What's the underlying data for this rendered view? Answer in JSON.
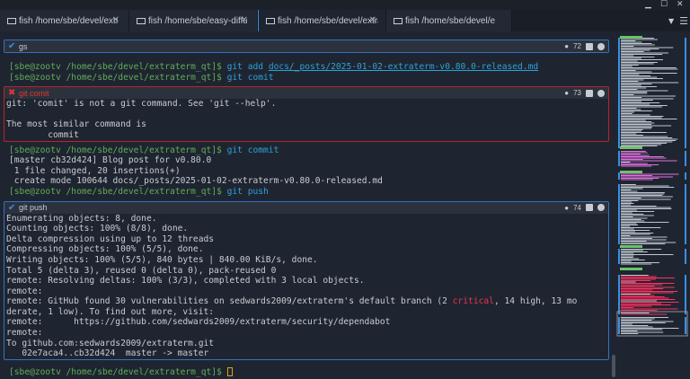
{
  "window": {
    "controls": [
      "minimize",
      "maximize",
      "close"
    ]
  },
  "tabs": [
    {
      "label": "fish /home/sbe/devel/extraterm_qt",
      "active": false
    },
    {
      "label": "fish /home/sbe/easy-diffusion/models",
      "active": false
    },
    {
      "label": "fish /home/sbe/devel/extraterm_qt",
      "active": true
    },
    {
      "label": "fish /home/sbe/devel/extraterm_qt",
      "active": false
    }
  ],
  "prompt": "[sbe@zootv /home/sbe/devel/extraterm_qt]$ ",
  "blocks": [
    {
      "status": "success",
      "title": "gs",
      "tag": "72"
    },
    {
      "status": "error",
      "title": "git comit",
      "tag": "73",
      "output": [
        "git: 'comit' is not a git command. See 'git --help'.",
        "",
        "The most similar command is",
        "        commit"
      ]
    },
    {
      "status": "success",
      "title": "git push",
      "tag": "74",
      "output": [
        "Enumerating objects: 8, done.",
        "Counting objects: 100% (8/8), done.",
        "Delta compression using up to 12 threads",
        "Compressing objects: 100% (5/5), done.",
        "Writing objects: 100% (5/5), 840 bytes | 840.00 KiB/s, done.",
        "Total 5 (delta 3), reused 0 (delta 0), pack-reused 0",
        "remote: Resolving deltas: 100% (3/3), completed with 3 local objects.",
        "remote:"
      ],
      "vuln_pre": "remote: GitHub found 30 vulnerabilities on sedwards2009/extraterm's default branch (2 ",
      "vuln_critical": "critical",
      "vuln_post": ", 14 high, 13 mo",
      "output2": [
        "derate, 1 low). To find out more, visit:",
        "remote:      https://github.com/sedwards2009/extraterm/security/dependabot",
        "remote:",
        "To github.com:sedwards2009/extraterm.git",
        "   02e7aca4..cb32d424  master -> master"
      ]
    }
  ],
  "lines": {
    "git": "git ",
    "add": "add ",
    "add_path": "docs/_posts/2025-01-02-extraterm-v0.80.0-released.md",
    "comit": "comit",
    "commit": "commit",
    "push": "push",
    "commit_out": [
      "[master cb32d424] Blog post for v0.80.0",
      " 1 file changed, 20 insertions(+)",
      " create mode 100644 docs/_posts/2025-01-02-extraterm-v0.80.0-released.md"
    ]
  },
  "colors": {
    "prompt": "#5fae5a",
    "command": "#2aa3d9",
    "success_border": "#3471c4",
    "error_border": "#b9232b",
    "critical": "#e8334f",
    "background": "#1f2530"
  }
}
